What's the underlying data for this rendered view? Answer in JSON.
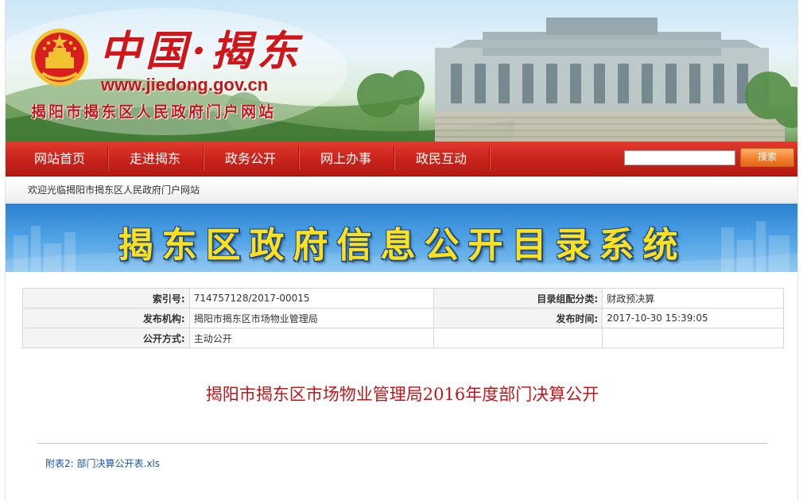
{
  "header": {
    "site_name": "中国·揭东",
    "site_url": "www.jiedong.gov.cn",
    "site_fullname": "揭阳市揭东区人民政府门户网站"
  },
  "nav": {
    "items": [
      {
        "label": "网站首页"
      },
      {
        "label": "走进揭东"
      },
      {
        "label": "政务公开"
      },
      {
        "label": "网上办事"
      },
      {
        "label": "政民互动"
      }
    ],
    "search_value": "",
    "search_button": "搜索"
  },
  "welcome_text": "欢迎光临揭阳市揭东区人民政府门户网站",
  "system_title": "揭东区政府信息公开目录系统",
  "meta": {
    "index_label": "索引号:",
    "index_value": "714757128/2017-00015",
    "category_label": "目录组配分类:",
    "category_value": "财政预决算",
    "publisher_label": "发布机构:",
    "publisher_value": "揭阳市揭东区市场物业管理局",
    "time_label": "发布时间:",
    "time_value": "2017-10-30 15:39:05",
    "method_label": "公开方式:",
    "method_value": "主动公开"
  },
  "article": {
    "title": "揭阳市揭东区市场物业管理局2016年度部门决算公开",
    "attachment_prefix": "附表2:",
    "attachment_link": "部门决算公开表.xls"
  },
  "colors": {
    "brand_red": "#c8231a",
    "title_red": "#c0161a",
    "banner_yellow": "#ffe01a",
    "link_blue": "#1a55a6"
  }
}
